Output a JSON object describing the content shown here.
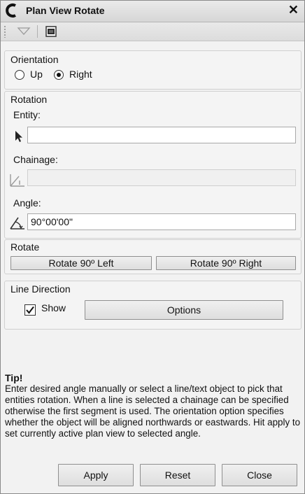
{
  "window": {
    "title": "Plan View Rotate"
  },
  "orientation": {
    "legend": "Orientation",
    "options": [
      {
        "label": "Up",
        "selected": false
      },
      {
        "label": "Right",
        "selected": true
      }
    ]
  },
  "rotation": {
    "legend": "Rotation",
    "entity_label": "Entity:",
    "entity_value": "",
    "chainage_label": "Chainage:",
    "chainage_value": "",
    "angle_label": "Angle:",
    "angle_value": "90°00'00\""
  },
  "rotate": {
    "legend": "Rotate",
    "left_button": "Rotate 90º Left",
    "right_button": "Rotate 90º Right"
  },
  "line_direction": {
    "legend": "Line Direction",
    "show_label": "Show",
    "show_checked": true,
    "options_button": "Options"
  },
  "tip": {
    "title": "Tip!",
    "text": "Enter desired angle manually or select a line/text object to pick that entities rotation. When a line is selected a chainage can be specified otherwise the first segment is used. The orientation option specifies whether the object will be aligned northwards or eastwards. Hit apply to set currently active plan view to selected angle."
  },
  "footer": {
    "apply": "Apply",
    "reset": "Reset",
    "close": "Close"
  },
  "icons": {
    "app": "c-logo-icon",
    "close": "close-icon",
    "toolbar_dropdown": "dropdown-triangle-icon",
    "toolbar_panel": "panel-icon",
    "entity_picker": "pointer-arrow-icon",
    "chainage_picker": "chainage-icon",
    "angle_picker": "angle-icon",
    "checkmark": "checkmark-icon"
  }
}
